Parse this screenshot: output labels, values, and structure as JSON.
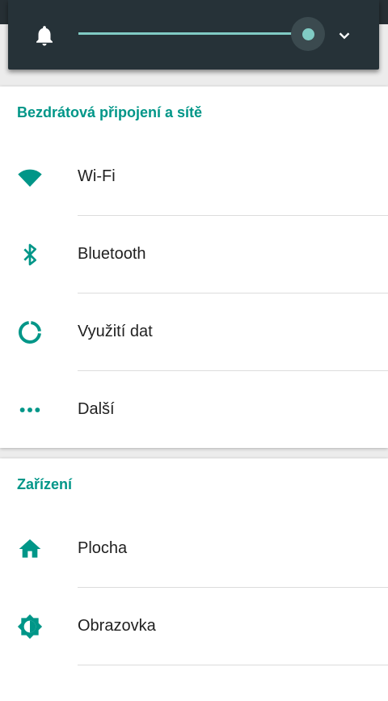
{
  "volume_panel": {
    "level": 0.99,
    "icons": {
      "left": "bell-icon",
      "right": "chevron-down-icon"
    },
    "accent": "#80cbc4"
  },
  "sections": [
    {
      "title": "Bezdrátová připojení a sítě",
      "items": [
        {
          "label": "Wi-Fi",
          "icon": "wifi-icon"
        },
        {
          "label": "Bluetooth",
          "icon": "bluetooth-icon"
        },
        {
          "label": "Využití dat",
          "icon": "data-usage-icon"
        },
        {
          "label": "Další",
          "icon": "more-icon"
        }
      ]
    },
    {
      "title": "Zařízení",
      "items": [
        {
          "label": "Plocha",
          "icon": "home-icon"
        },
        {
          "label": "Obrazovka",
          "icon": "brightness-icon"
        }
      ]
    }
  ],
  "colors": {
    "accent": "#009688",
    "text": "#212121",
    "panel": "#263238"
  }
}
